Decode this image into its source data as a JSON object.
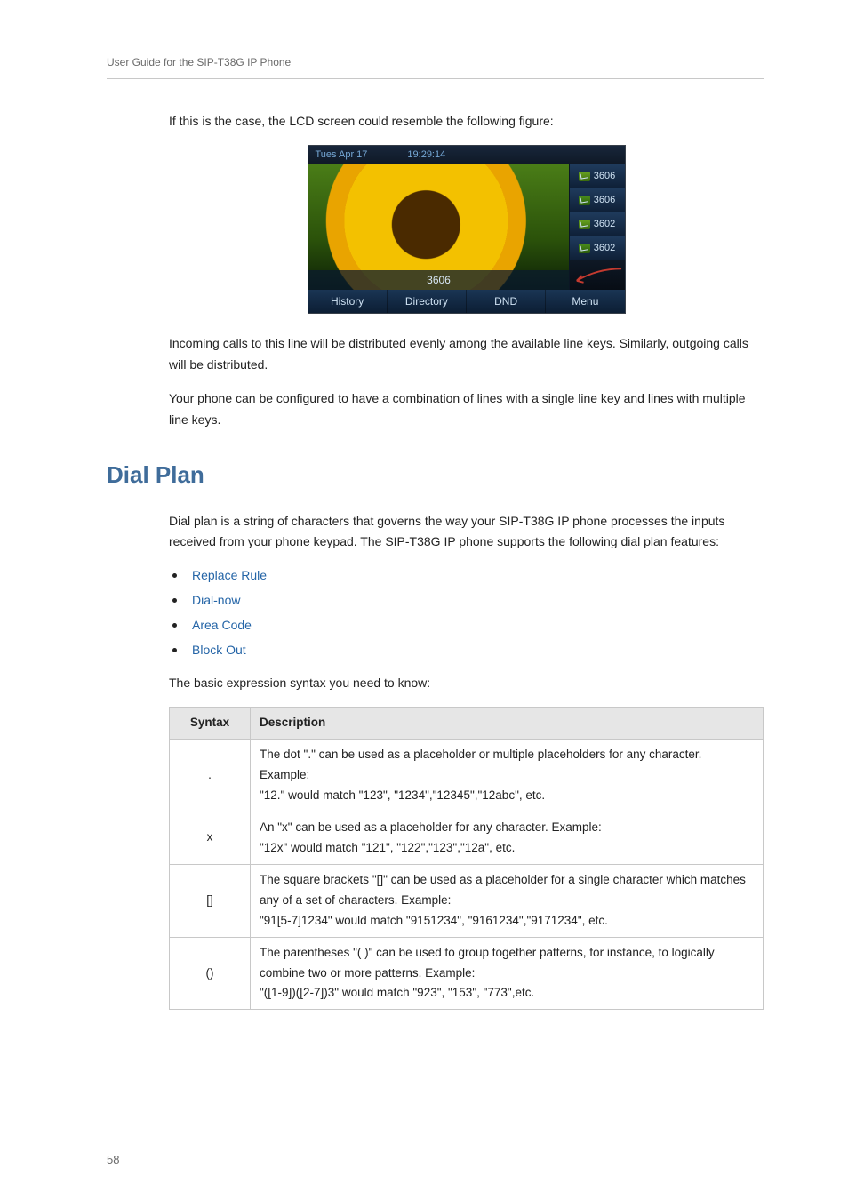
{
  "running_head": "User Guide for the SIP-T38G IP Phone",
  "page_number": "58",
  "intro": {
    "p1": "If this is the case, the LCD screen could resemble the following figure:",
    "p2": "Incoming calls to this line will be distributed evenly among the available line keys. Similarly, outgoing calls will be distributed.",
    "p3": "Your phone can be configured to have a combination of lines with a single line key and lines with multiple line keys."
  },
  "phone": {
    "status_date": "Tues Apr 17",
    "status_time": "19:29:14",
    "ext": "3606",
    "rail": [
      "3606",
      "3606",
      "3602",
      "3602"
    ],
    "softkeys": [
      "History",
      "Directory",
      "DND",
      "Menu"
    ]
  },
  "section": {
    "title": "Dial Plan",
    "lead": "Dial plan is a string of characters that governs the way your SIP-T38G IP phone processes the inputs received from your phone keypad. The SIP-T38G IP phone supports the following dial plan features:",
    "bullets": [
      "Replace Rule",
      "Dial-now",
      "Area Code",
      "Block Out"
    ],
    "syntax_intro": "The basic expression syntax you need to know:"
  },
  "table": {
    "headers": {
      "syntax": "Syntax",
      "description": "Description"
    },
    "rows": [
      {
        "symbol": ".",
        "lines": [
          "The dot \".\" can be used as a placeholder or multiple placeholders for any character. Example:",
          "\"12.\" would match \"123\", \"1234\",\"12345\",\"12abc\", etc."
        ]
      },
      {
        "symbol": "x",
        "lines": [
          "An \"x\" can be used as a placeholder for any character. Example:",
          "\"12x\" would match \"121\", \"122\",\"123\",\"12a\", etc."
        ]
      },
      {
        "symbol": "[]",
        "lines": [
          "The square brackets \"[]\" can be used as a placeholder for a single character which matches any of a set of characters. Example:",
          "\"91[5-7]1234\" would match \"9151234\", \"9161234\",\"9171234\", etc."
        ]
      },
      {
        "symbol": "()",
        "lines": [
          "The parentheses \"( )\" can be used to group together patterns, for instance, to logically combine two or more patterns. Example:",
          "\"([1-9])([2-7])3\" would match \"923\", \"153\", \"773\",etc."
        ]
      }
    ]
  }
}
